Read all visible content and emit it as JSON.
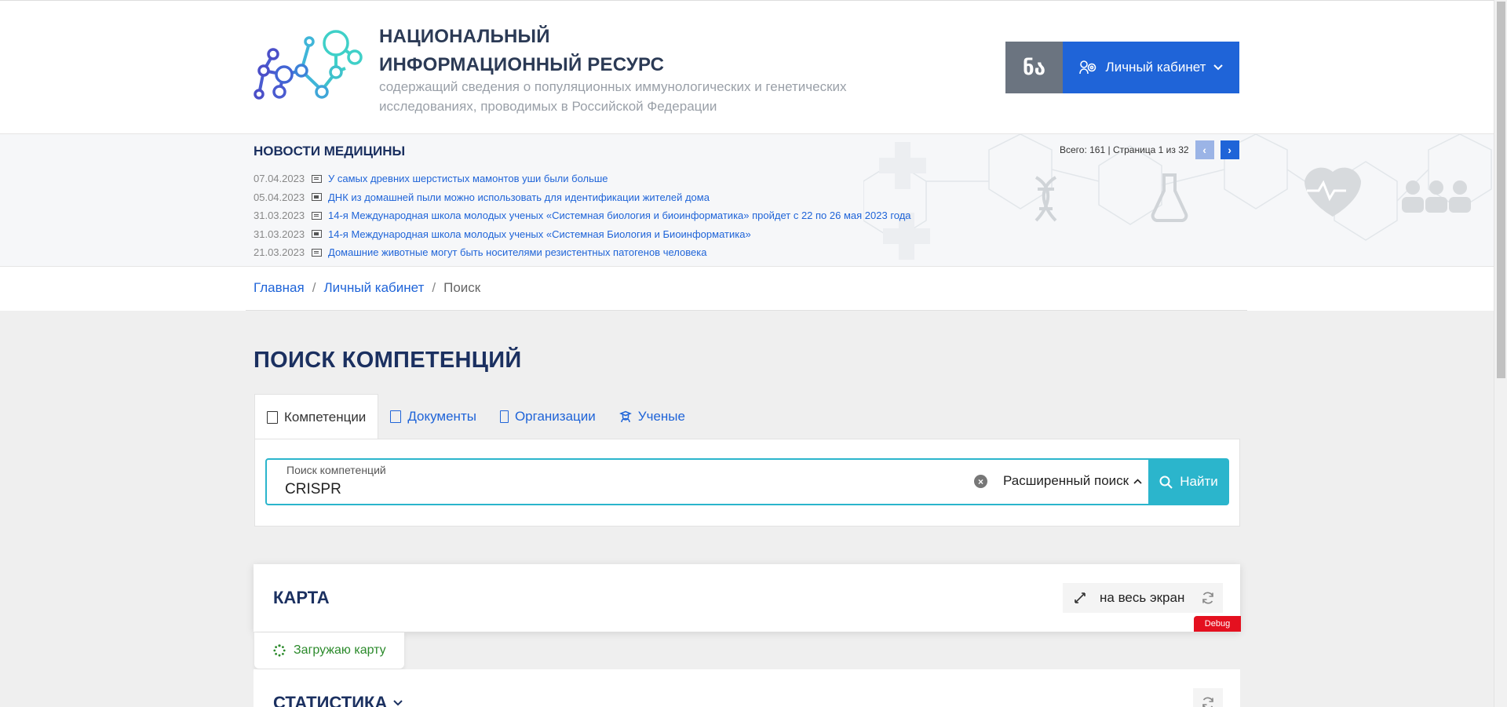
{
  "header": {
    "title_line1": "НАЦИОНАЛЬНЫЙ",
    "title_line2": "ИНФОРМАЦИОННЫЙ РЕСУРС",
    "subtitle": "содержащий сведения о популяционных иммунологических и генетических исследованиях, проводимых в Российской Федерации",
    "vision_label": "ნა",
    "cabinet_label": "Личный кабинет"
  },
  "news": {
    "title": "НОВОСТИ МЕДИЦИНЫ",
    "pager": "Всего: 161 | Страница 1 из 32",
    "items": [
      {
        "date": "07.04.2023",
        "text": "У самых древних шерстистых мамонтов уши были больше"
      },
      {
        "date": "05.04.2023",
        "text": "ДНК из домашней пыли можно использовать для идентификации жителей дома"
      },
      {
        "date": "31.03.2023",
        "text": "14-я Международная школа молодых ученых «Системная биология и биоинформатика» пройдет с 22 по 26 мая 2023 года"
      },
      {
        "date": "31.03.2023",
        "text": "14-я Международная школа молодых ученых «Системная Биология и Биоинформатика»"
      },
      {
        "date": "21.03.2023",
        "text": "Домашние животные могут быть носителями резистентных патогенов человека"
      }
    ]
  },
  "breadcrumb": {
    "home": "Главная",
    "cabinet": "Личный кабинет",
    "current": "Поиск",
    "sep": "/"
  },
  "main": {
    "title": "ПОИСК КОМПЕТЕНЦИЙ",
    "tabs": [
      {
        "label": "Компетенции",
        "active": true
      },
      {
        "label": "Документы",
        "active": false
      },
      {
        "label": "Организации",
        "active": false
      },
      {
        "label": "Ученые",
        "active": false
      }
    ],
    "search": {
      "label": "Поиск компетенций",
      "value": "CRISPR",
      "advanced_label": "Расширенный поиск",
      "find_label": "Найти"
    }
  },
  "map": {
    "title": "КАРТА",
    "fullscreen_label": "на весь экран",
    "debug_label": "Debug",
    "loading_label": "Загружаю карту"
  },
  "stats": {
    "title": "СТАТИСТИКА"
  },
  "colors": {
    "brand_blue": "#1f64d8",
    "accent_teal": "#2bb5cc",
    "title_navy": "#1b3060",
    "debug_red": "#e4101f"
  }
}
